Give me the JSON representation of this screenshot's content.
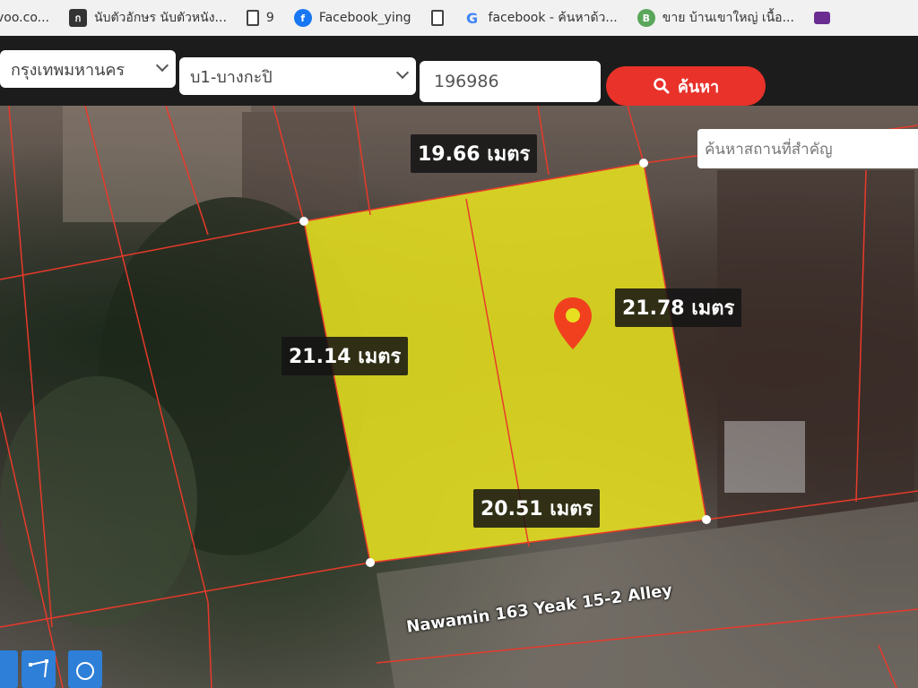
{
  "bookmarks": [
    {
      "icon": "doc-icon",
      "label": "voo.co..."
    },
    {
      "icon": "app-icon",
      "label": "นับตัวอักษร นับตัวหนัง..."
    },
    {
      "icon": "doc-icon",
      "label": "9"
    },
    {
      "icon": "facebook-icon",
      "label": "Facebook_ying"
    },
    {
      "icon": "doc-icon",
      "label": ""
    },
    {
      "icon": "google-icon",
      "label": "facebook - ค้นหาด้ว..."
    },
    {
      "icon": "green-site-icon",
      "label": "ขาย บ้านเขาใหญ่ เนื้อ..."
    },
    {
      "icon": "purple-site-icon",
      "label": ""
    }
  ],
  "search": {
    "province": "กรุงเทพมหานคร",
    "district": "บ1-บางกะปิ",
    "parcel_code": "196986",
    "button_label": "ค้นหา",
    "place_placeholder": "ค้นหาสถานที่สำคัญ"
  },
  "parcel": {
    "top_dim": "19.66 เมตร",
    "left_dim": "21.14 เมตร",
    "right_dim": "21.78 เมตร",
    "bottom_dim": "20.51 เมตร",
    "fill_color": "#e6e020",
    "line_color": "#e83a2a"
  },
  "road_name": "Nawamin 163 Yeak 15-2 Alley",
  "tools": [
    {
      "icon": "polygon-tool-icon"
    },
    {
      "icon": "circle-tool-icon"
    }
  ]
}
